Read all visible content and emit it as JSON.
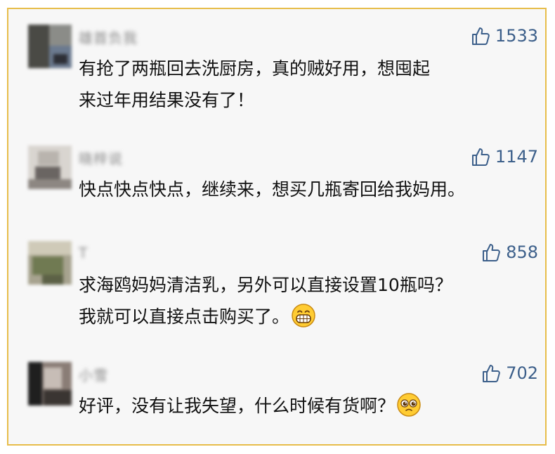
{
  "comments": [
    {
      "username": "雄首负我",
      "likes": "1533",
      "lines": [
        "有抢了两瓶回去洗厨房，真的贼好用，想囤起",
        "来过年用结果没有了！"
      ],
      "avatar_colors": [
        "#4a4a45",
        "#8b8c88",
        "#6b7a8f",
        "#2d2f36"
      ]
    },
    {
      "username": "晓梓说",
      "likes": "1147",
      "lines": [
        "快点快点快点，继续来，想买几瓶寄回给我妈用。"
      ],
      "avatar_colors": [
        "#d9d5d0",
        "#6a6562",
        "#b9b4ae",
        "#8d8782"
      ]
    },
    {
      "username": "T",
      "likes": "858",
      "lines": [
        "求海鸥妈妈清洁乳，另外可以直接设置10瓶吗？",
        "我就可以直接点击购买了。"
      ],
      "emoji": "grin-emoji",
      "avatar_colors": [
        "#707a52",
        "#a7a38f",
        "#cfcab8",
        "#5c6146"
      ]
    },
    {
      "username": "小雪",
      "likes": "702",
      "lines": [
        "好评，没有让我失望，什么时候有货啊？"
      ],
      "emoji": "pleading-emoji",
      "avatar_colors": [
        "#1f1f1f",
        "#8a7d76",
        "#c7bdb6",
        "#3a3532"
      ]
    }
  ],
  "colors": {
    "border": "#e7bd4a",
    "likes": "#3c5f8a",
    "text": "#111111"
  }
}
